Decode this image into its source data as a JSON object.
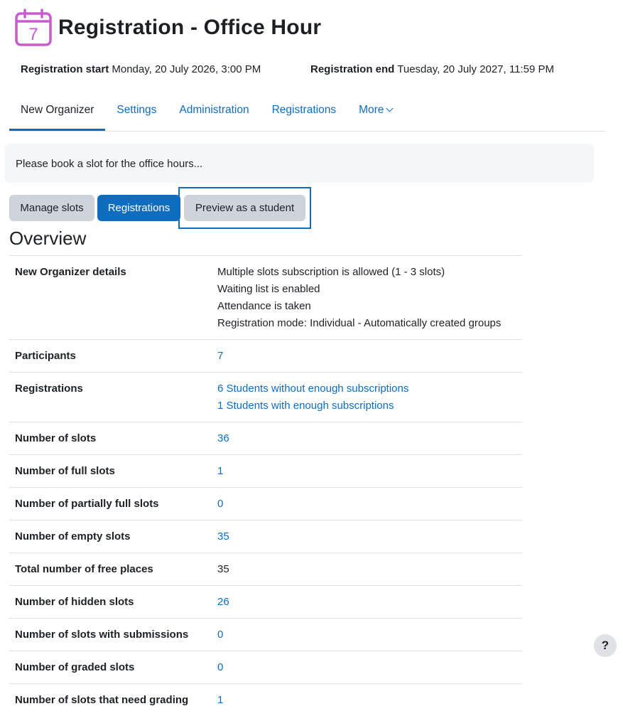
{
  "header": {
    "title": "Registration - Office Hour",
    "icon": "calendar-icon",
    "icon_day": "7",
    "icon_color": "#c95ad4"
  },
  "dates": {
    "start_label": "Registration start",
    "start_value": "Monday, 20 July 2026, 3:00 PM",
    "end_label": "Registration end",
    "end_value": "Tuesday, 20 July 2027, 11:59 PM"
  },
  "nav": {
    "tabs": [
      "New Organizer",
      "Settings",
      "Administration",
      "Registrations",
      "More"
    ]
  },
  "intro": "Please book a slot for the office hours...",
  "buttons": {
    "manage": "Manage slots",
    "registrations": "Registrations",
    "preview": "Preview as a student"
  },
  "overview": {
    "title": "Overview",
    "details_label": "New Organizer details",
    "details_lines": [
      "Multiple slots subscription is allowed (1 - 3 slots)",
      "Waiting list is enabled",
      "Attendance is taken",
      "Registration mode: Individual - Automatically created groups"
    ],
    "participants_label": "Participants",
    "participants_value": "7",
    "registrations_label": "Registrations",
    "registrations_lines": [
      "6 Students without enough subscriptions",
      "1 Students with enough subscriptions"
    ],
    "slots_label": "Number of slots",
    "slots_value": "36",
    "full_label": "Number of full slots",
    "full_value": "1",
    "partial_label": "Number of partially full slots",
    "partial_value": "0",
    "empty_label": "Number of empty slots",
    "empty_value": "35",
    "free_label": "Total number of free places",
    "free_value": "35",
    "hidden_label": "Number of hidden slots",
    "hidden_value": "26",
    "submissions_label": "Number of slots with submissions",
    "submissions_value": "0",
    "graded_label": "Number of graded slots",
    "graded_value": "0",
    "needgrading_label": "Number of slots that need grading",
    "needgrading_value": "1"
  },
  "help": "?",
  "colors": {
    "accent": "#0f6cbf",
    "button_grey": "#ced4da"
  }
}
